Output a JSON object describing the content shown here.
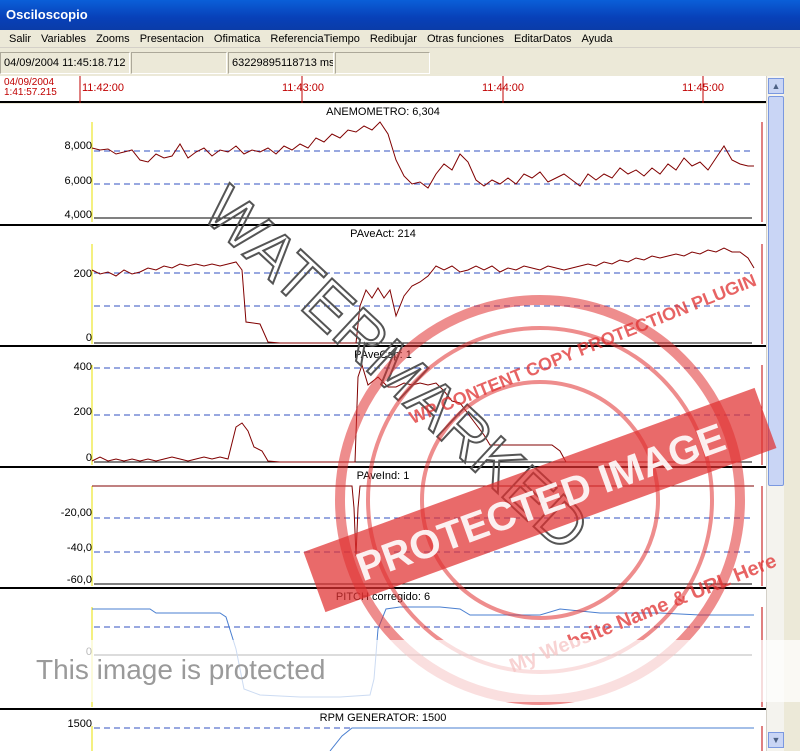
{
  "window": {
    "title": "Osciloscopio"
  },
  "menu": [
    "Salir",
    "Variables",
    "Zooms",
    "Presentacion",
    "Ofimatica",
    "ReferenciaTiempo",
    "Redibujar",
    "Otras funciones",
    "EditarDatos",
    "Ayuda"
  ],
  "status": {
    "datetime": "04/09/2004 11:45:18.712",
    "field2": "",
    "ms": "63229895118713 ms",
    "field4": ""
  },
  "timebar": {
    "date": "04/09/2004",
    "time": "1:41:57.215",
    "ticks": [
      "11:42:00",
      "11:43:00",
      "11:44:00",
      "11:45:00"
    ]
  },
  "panels": [
    {
      "title": "ANEMOMETRO: 6,304",
      "ylabels": [
        "8,000",
        "6,000",
        "4,000"
      ],
      "color": "#800000"
    },
    {
      "title": "PAveAct: 214",
      "ylabels": [
        "200",
        "0"
      ],
      "color": "#800000"
    },
    {
      "title": "PAveCap: 1",
      "ylabels": [
        "400",
        "200",
        "0"
      ],
      "color": "#800000"
    },
    {
      "title": "PAveInd: 1",
      "ylabels": [
        "-20,00",
        "-40,0",
        "-60,0"
      ],
      "color": "#800000"
    },
    {
      "title": "PITCH corregido: 6",
      "ylabels": [
        "0"
      ],
      "color": "#4a7fd0"
    },
    {
      "title": "RPM GENERATOR: 1500",
      "ylabels": [
        "1500"
      ],
      "color": "#4a7fd0"
    }
  ],
  "watermark": {
    "diagonal": "WATERMARKED",
    "stamp_top": "WP CONTENT COPY PROTECTION PLUGIN",
    "stamp_middle": "PROTECTED IMAGE",
    "stamp_bottom": "My Website Name & URL Here",
    "banner": "This image is protected"
  },
  "colors": {
    "trace_red": "#800000",
    "trace_blue": "#4a7fd0",
    "dashed_blue": "#3050c0",
    "stamp_red": "#e03030",
    "time_red": "#c00000"
  }
}
